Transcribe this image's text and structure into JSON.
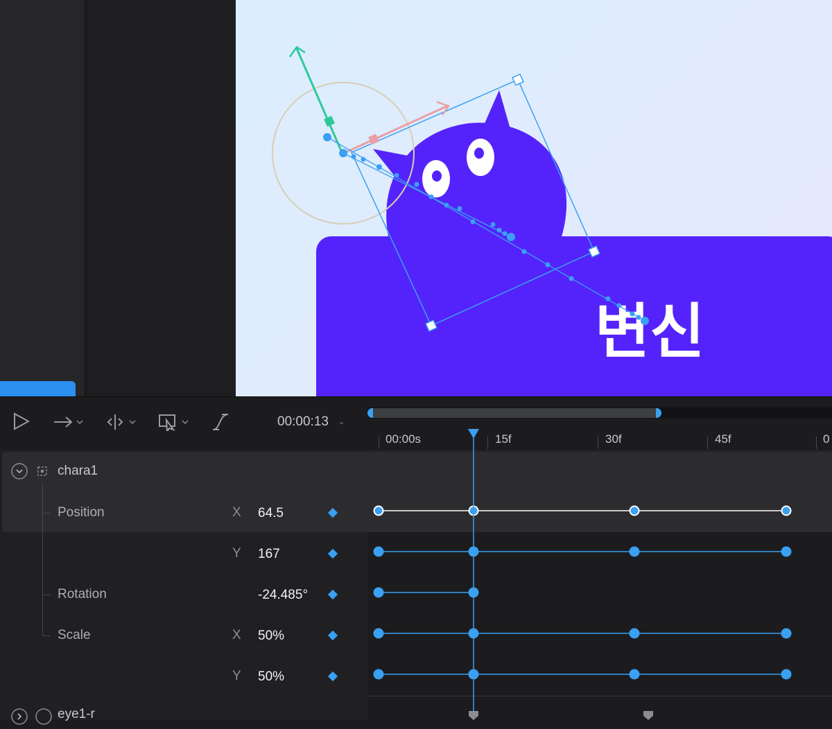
{
  "canvas": {
    "badge_text": "변신",
    "colors": {
      "brand": "#5423fb",
      "selection": "#3aa0f2",
      "background_start": "#dbeefe",
      "background_end": "#e6e8fc"
    }
  },
  "toolbar": {
    "play_icon": "play-icon",
    "motion_icon": "arrow-right-icon",
    "anchor_icon": "anchor-split-icon",
    "select_icon": "select-cursor-icon",
    "easing_icon": "easing-curve-icon",
    "timecode": "00:00:13"
  },
  "ruler": {
    "labels": [
      "00:00s",
      "15f",
      "30f",
      "45f",
      "0"
    ]
  },
  "layers": {
    "group_name": "chara1",
    "next_layer": "eye1-r",
    "properties": [
      {
        "label": "Position",
        "axis": "X",
        "value": "64.5"
      },
      {
        "label": "",
        "axis": "Y",
        "value": "167"
      },
      {
        "label": "Rotation",
        "axis": "",
        "value": "-24.485°"
      },
      {
        "label": "Scale",
        "axis": "X",
        "value": "50%"
      },
      {
        "label": "",
        "axis": "Y",
        "value": "50%"
      }
    ]
  },
  "colors": {
    "accent": "#3aa0f2",
    "panel": "#1c1c1e"
  }
}
